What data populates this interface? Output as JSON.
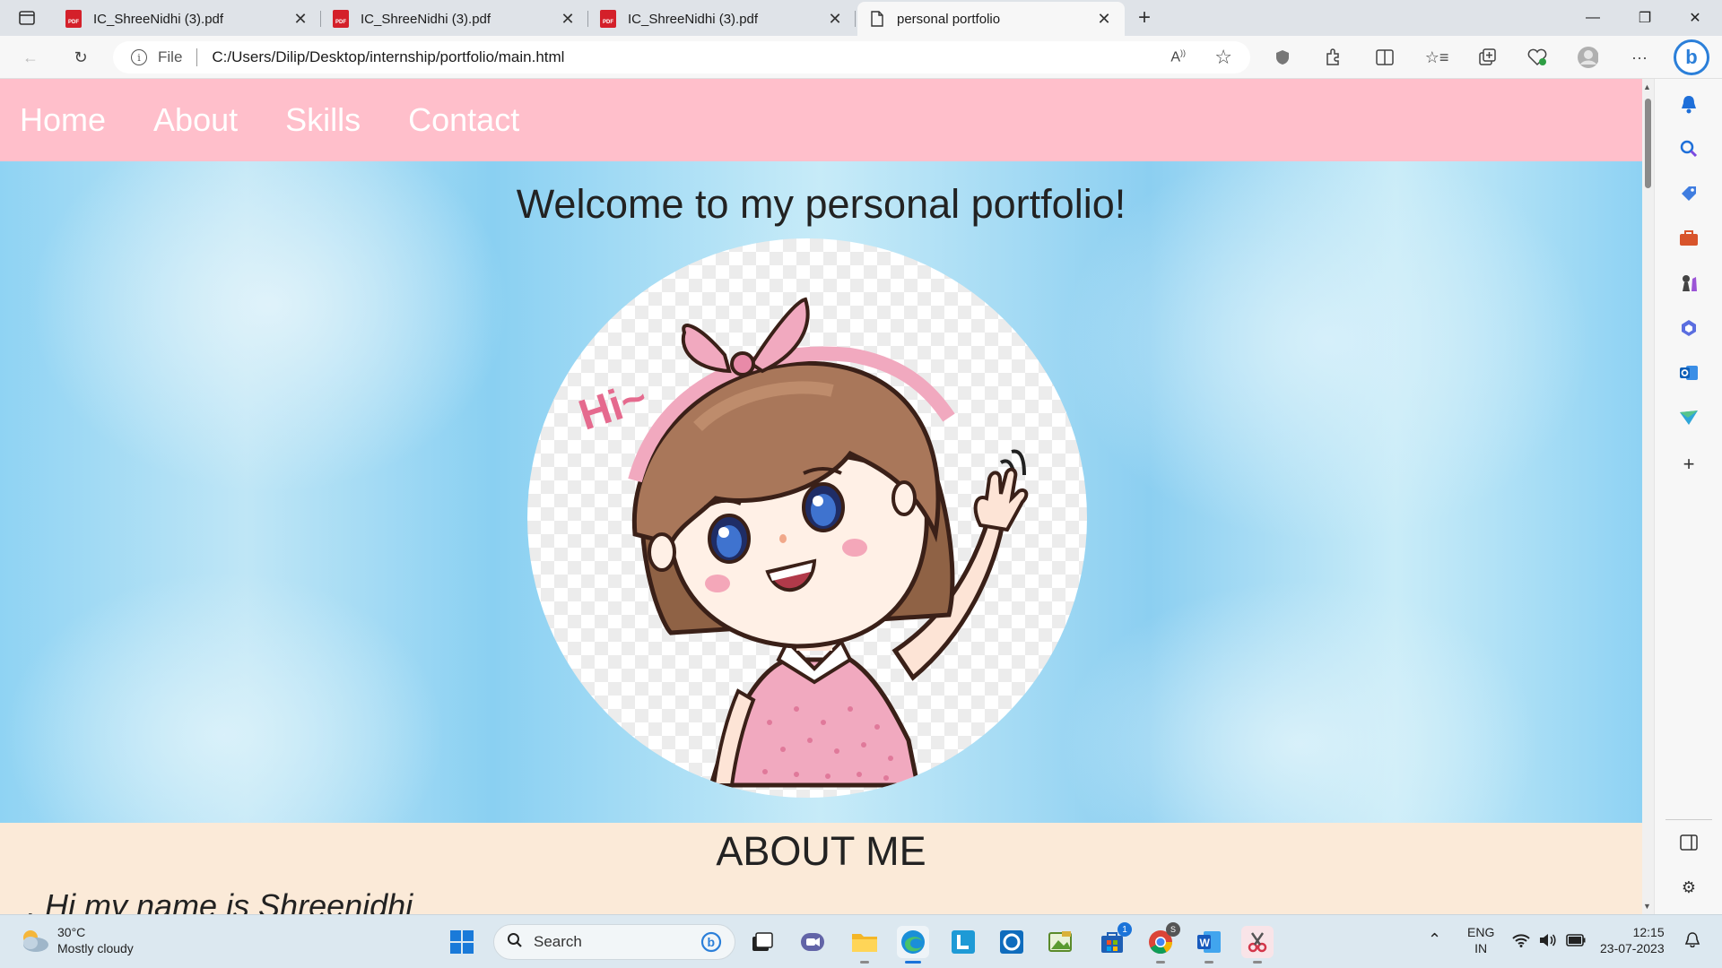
{
  "browser": {
    "tabs": [
      {
        "title": "IC_ShreeNidhi (3).pdf",
        "icon": "pdf-icon",
        "active": false
      },
      {
        "title": "IC_ShreeNidhi (3).pdf",
        "icon": "pdf-icon",
        "active": false
      },
      {
        "title": "IC_ShreeNidhi (3).pdf",
        "icon": "pdf-icon",
        "active": false
      },
      {
        "title": "personal portfolio",
        "icon": "page-icon",
        "active": true
      }
    ],
    "address": {
      "scheme_label": "File",
      "url": "C:/Users/Dilip/Desktop/internship/portfolio/main.html"
    },
    "pdf_badge": "PDF"
  },
  "page": {
    "nav": [
      "Home",
      "About",
      "Skills",
      "Contact"
    ],
    "hero_title": "Welcome to my personal portfolio!",
    "avatar_greeting": "Hi~",
    "about_title": "ABOUT ME",
    "about_text": ". Hi my name is Shreenidhi"
  },
  "colors": {
    "nav_bg": "#ffbfcb",
    "about_bg": "#fbead8",
    "hero_bg": "#8fd3f3"
  },
  "taskbar": {
    "weather_temp": "30°C",
    "weather_desc": "Mostly cloudy",
    "search_placeholder": "Search",
    "store_badge": "1",
    "chrome_badge": "S",
    "lang_top": "ENG",
    "lang_bottom": "IN",
    "time": "12:15",
    "date": "23-07-2023"
  }
}
